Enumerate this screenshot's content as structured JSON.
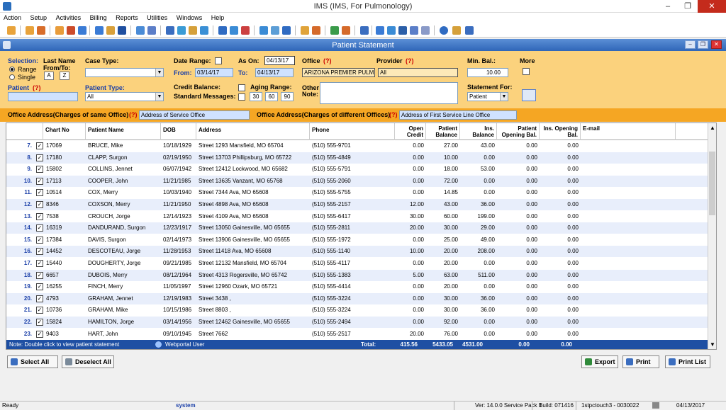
{
  "window": {
    "title": "IMS (IMS, For Pulmonology)",
    "min": "–",
    "restore": "❐",
    "close": "✕"
  },
  "menu": [
    "Action",
    "Setup",
    "Activities",
    "Billing",
    "Reports",
    "Utilities",
    "Windows",
    "Help"
  ],
  "inner_window": {
    "title": "Patient Statement"
  },
  "filters": {
    "selection_label": "Selection:",
    "range_label": "Range",
    "single_label": "Single",
    "last_name_label": "Last Name",
    "from_to_label": "From/To:",
    "from_letter": "A",
    "to_letter": "Z",
    "patient_label": "Patient",
    "req_mark": "(?)",
    "case_type_label": "Case Type:",
    "case_type_value": "",
    "patient_type_label": "Patient Type:",
    "patient_type_value": "All",
    "date_range_label": "Date Range:",
    "as_on_label": "As On:",
    "as_on_value": "04/13/17",
    "from_label": "From:",
    "from_date": "03/14/17",
    "to_label": "To:",
    "to_date": "04/13/17",
    "credit_balance_label": "Credit Balance:",
    "aging_range_label": "Aging Range:",
    "standard_messages_label": "Standard Messages:",
    "aging_values": [
      "30",
      "60",
      "90"
    ],
    "office_label": "Office",
    "office_value": "ARIZONA PREMIER PULM",
    "provider_label": "Provider",
    "provider_value": "All",
    "other_note_label_1": "Other",
    "other_note_label_2": "Note:",
    "min_bal_label": "Min. Bal.:",
    "min_bal_value": "10.00",
    "statement_for_label": "Statement For:",
    "statement_for_value": "Patient",
    "more_label": "More"
  },
  "address_bar": {
    "same_label": "Office Address(Charges of same Office)",
    "same_value": "Address of Service Office",
    "diff_label": "Office Address(Charges of different Offices)",
    "diff_value": "Address of First Service Line Office",
    "req_mark": "(?)"
  },
  "grid": {
    "headers": {
      "chart_no": "Chart No",
      "patient_name": "Patient Name",
      "dob": "DOB",
      "address": "Address",
      "phone": "Phone",
      "open_credit": "Open Credit",
      "patient_balance": "Patient Balance",
      "ins_balance": "Ins. Balance",
      "patient_opening": "Patient Opening Bal.",
      "ins_opening": "Ins. Opening Bal.",
      "email": "E-mail"
    },
    "rows": [
      {
        "n": "7.",
        "chart": "17069",
        "name": "BRUCE, Mike",
        "dob": "10/18/1929",
        "addr": "Street 1293 Mansfield, MO 65704",
        "phone": "(510) 555-9701",
        "oc": "0.00",
        "pb": "27.00",
        "ib": "43.00",
        "po": "0.00",
        "io": "0.00"
      },
      {
        "n": "8.",
        "chart": "17180",
        "name": "CLAPP, Surgon",
        "dob": "02/19/1950",
        "addr": "Street 13703 Phillipsburg, MO 65722",
        "phone": "(510) 555-4849",
        "oc": "0.00",
        "pb": "10.00",
        "ib": "0.00",
        "po": "0.00",
        "io": "0.00"
      },
      {
        "n": "9.",
        "chart": "15802",
        "name": "COLLINS, Jennet",
        "dob": "06/07/1942",
        "addr": "Street 12412 Lockwood, MO 65682",
        "phone": "(510) 555-5791",
        "oc": "0.00",
        "pb": "18.00",
        "ib": "53.00",
        "po": "0.00",
        "io": "0.00"
      },
      {
        "n": "10.",
        "chart": "17113",
        "name": "COOPER, John",
        "dob": "11/21/1985",
        "addr": "Street 13635 Vanzant, MO 65768",
        "phone": "(510) 555-2060",
        "oc": "0.00",
        "pb": "72.00",
        "ib": "0.00",
        "po": "0.00",
        "io": "0.00"
      },
      {
        "n": "11.",
        "chart": "10514",
        "name": "COX, Merry",
        "dob": "10/03/1940",
        "addr": "Street 7344 Ava, MO 65608",
        "phone": "(510) 555-5755",
        "oc": "0.00",
        "pb": "14.85",
        "ib": "0.00",
        "po": "0.00",
        "io": "0.00"
      },
      {
        "n": "12.",
        "chart": "8346",
        "name": "COXSON, Merry",
        "dob": "11/21/1950",
        "addr": "Street 4898 Ava, MO 65608",
        "phone": "(510) 555-2157",
        "oc": "12.00",
        "pb": "43.00",
        "ib": "36.00",
        "po": "0.00",
        "io": "0.00"
      },
      {
        "n": "13.",
        "chart": "7538",
        "name": "CROUCH, Jorge",
        "dob": "12/14/1923",
        "addr": "Street 4109 Ava, MO 65608",
        "phone": "(510) 555-6417",
        "oc": "30.00",
        "pb": "60.00",
        "ib": "199.00",
        "po": "0.00",
        "io": "0.00"
      },
      {
        "n": "14.",
        "chart": "16319",
        "name": "DANDURAND, Surgon",
        "dob": "12/23/1917",
        "addr": "Street 13050 Gainesville, MO 65655",
        "phone": "(510) 555-2811",
        "oc": "20.00",
        "pb": "30.00",
        "ib": "29.00",
        "po": "0.00",
        "io": "0.00"
      },
      {
        "n": "15.",
        "chart": "17384",
        "name": "DAVIS, Surgon",
        "dob": "02/14/1973",
        "addr": "Street 13906 Gainesville, MO 65655",
        "phone": "(510) 555-1972",
        "oc": "0.00",
        "pb": "25.00",
        "ib": "49.00",
        "po": "0.00",
        "io": "0.00"
      },
      {
        "n": "16.",
        "chart": "14452",
        "name": "DESCOTEAU, Jorge",
        "dob": "11/28/1953",
        "addr": "Street 11418 Ava, MO 65608",
        "phone": "(510) 555-1140",
        "oc": "10.00",
        "pb": "20.00",
        "ib": "208.00",
        "po": "0.00",
        "io": "0.00"
      },
      {
        "n": "17.",
        "chart": "15440",
        "name": "DOUGHERTY, Jorge",
        "dob": "09/21/1985",
        "addr": "Street 12132 Mansfield, MO 65704",
        "phone": "(510) 555-4117",
        "oc": "0.00",
        "pb": "20.00",
        "ib": "0.00",
        "po": "0.00",
        "io": "0.00"
      },
      {
        "n": "18.",
        "chart": "6657",
        "name": "DUBOIS, Merry",
        "dob": "08/12/1964",
        "addr": "Street 4313 Rogersville, MO 65742",
        "phone": "(510) 555-1383",
        "oc": "5.00",
        "pb": "63.00",
        "ib": "511.00",
        "po": "0.00",
        "io": "0.00"
      },
      {
        "n": "19.",
        "chart": "16255",
        "name": "FINCH, Merry",
        "dob": "11/05/1997",
        "addr": "Street 12960 Ozark, MO 65721",
        "phone": "(510) 555-4414",
        "oc": "0.00",
        "pb": "20.00",
        "ib": "0.00",
        "po": "0.00",
        "io": "0.00"
      },
      {
        "n": "20.",
        "chart": "4793",
        "name": "GRAHAM, Jennet",
        "dob": "12/19/1983",
        "addr": "Street 3438 ,",
        "phone": "(510) 555-3224",
        "oc": "0.00",
        "pb": "30.00",
        "ib": "36.00",
        "po": "0.00",
        "io": "0.00"
      },
      {
        "n": "21.",
        "chart": "10736",
        "name": "GRAHAM, Mike",
        "dob": "10/15/1986",
        "addr": "Street 8803 ,",
        "phone": "(510) 555-3224",
        "oc": "0.00",
        "pb": "30.00",
        "ib": "36.00",
        "po": "0.00",
        "io": "0.00"
      },
      {
        "n": "22.",
        "chart": "15824",
        "name": "HAMILTON, Jorge",
        "dob": "03/14/1956",
        "addr": "Street 12462 Gainesville, MO 65655",
        "phone": "(510) 555-2494",
        "oc": "0.00",
        "pb": "92.00",
        "ib": "0.00",
        "po": "0.00",
        "io": "0.00"
      },
      {
        "n": "23.",
        "chart": "9403",
        "name": "HART, John",
        "dob": "09/10/1945",
        "addr": "Street 7662",
        "phone": "(510) 555-2517",
        "oc": "20.00",
        "pb": "76.00",
        "ib": "0.00",
        "po": "0.00",
        "io": "0.00"
      }
    ],
    "footer": {
      "note": "Note: Double click to view patient statement",
      "webportal": "Webportal User",
      "total_label": "Total:",
      "total_open_credit": "415.56",
      "total_patient_balance": "5433.05",
      "total_ins_balance": "4531.00",
      "total_patient_opening": "0.00",
      "total_ins_opening": "0.00"
    }
  },
  "buttons": {
    "select_all": "Select All",
    "deselect_all": "Deselect All",
    "export": "Export",
    "print": "Print",
    "print_list": "Print List"
  },
  "status": {
    "ready": "Ready",
    "user": "system",
    "version": "Ver: 14.0.0 Service Pack 1",
    "build": "Build: 071416",
    "server": "1stpctouch3 - 0030022",
    "date": "04/13/2017"
  },
  "colors": {
    "filter_bg": "#fbd27d",
    "address_bg": "#f5a623",
    "footer_bg": "#1e4fa3",
    "row_alt": "#e8eefb"
  }
}
